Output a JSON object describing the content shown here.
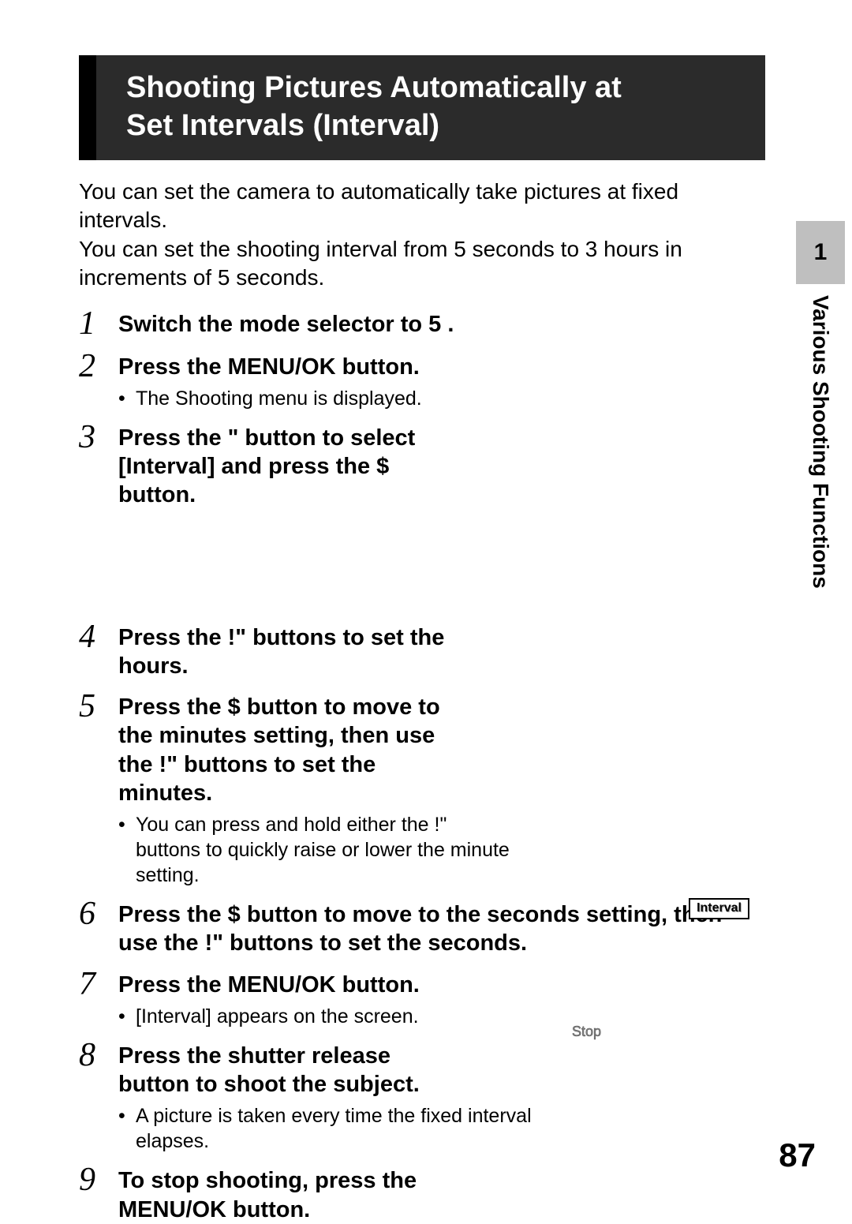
{
  "header": {
    "title_line1": "Shooting Pictures Automatically at",
    "title_line2": "Set Intervals (Interval)"
  },
  "intro": {
    "p1": "You can set the camera to automatically take pictures at fixed intervals.",
    "p2": "You can set the shooting interval from 5 seconds to 3 hours in increments of 5 seconds."
  },
  "steps": [
    {
      "num": "1",
      "title": "Switch the mode selector to 5 .",
      "bullets": []
    },
    {
      "num": "2",
      "title": "Press the MENU/OK button.",
      "bullets": [
        "The Shooting menu is displayed."
      ]
    },
    {
      "num": "3",
      "title": "Press the \"  button to select [Interval] and press the $ button.",
      "bullets": []
    },
    {
      "num": "4",
      "title": "Press the !\"   buttons to set the hours.",
      "bullets": []
    },
    {
      "num": "5",
      "title": "Press the $ button to move to the minutes setting, then use the !\"   buttons to set the minutes.",
      "bullets": [
        "You can press and hold either the !\" buttons to quickly raise or lower the minute setting."
      ]
    },
    {
      "num": "6",
      "title": "Press the $ button to move to the seconds setting, then use the !\"   buttons to set the seconds.",
      "bullets": []
    },
    {
      "num": "7",
      "title": "Press the MENU/OK button.",
      "bullets": [
        "[Interval] appears on the screen."
      ]
    },
    {
      "num": "8",
      "title": "Press the shutter release button to shoot the subject.",
      "bullets": [
        "A picture is taken every time the fixed interval elapses."
      ]
    },
    {
      "num": "9",
      "title": "To stop shooting, press the MENU/OK button.",
      "bullets": []
    }
  ],
  "sidetab": {
    "number": "1",
    "label": "Various Shooting Functions"
  },
  "overlay": {
    "interval": "Interval",
    "stop": "Stop"
  },
  "pagenum": "87"
}
